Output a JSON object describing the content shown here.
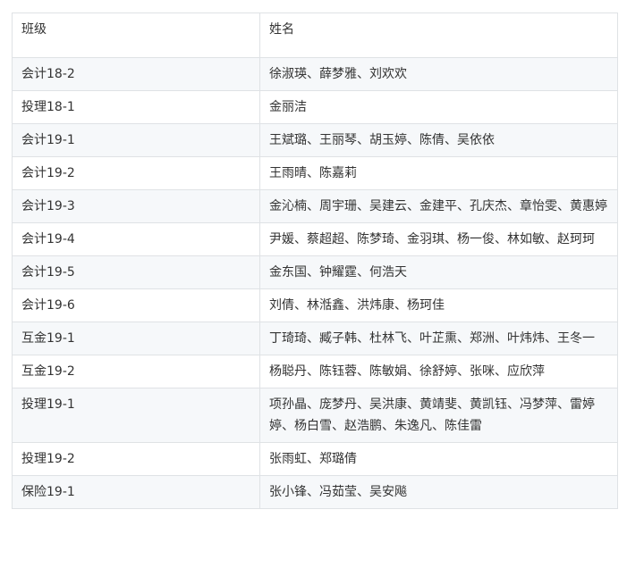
{
  "table": {
    "headers": [
      "班级",
      "姓名"
    ],
    "rows": [
      [
        "会计18-2",
        "徐淑瑛、薛梦雅、刘欢欢"
      ],
      [
        "投理18-1",
        "金丽洁"
      ],
      [
        "会计19-1",
        "王斌璐、王丽琴、胡玉婷、陈倩、吴依依"
      ],
      [
        "会计19-2",
        "王雨晴、陈嘉莉"
      ],
      [
        "会计19-3",
        "金沁楠、周宇珊、吴建云、金建平、孔庆杰、章怡雯、黄惠婷"
      ],
      [
        "会计19-4",
        "尹媛、蔡超超、陈梦琦、金羽琪、杨一俊、林如敏、赵珂珂"
      ],
      [
        "会计19-5",
        "金东国、钟耀霆、何浩天"
      ],
      [
        "会计19-6",
        "刘倩、林湉鑫、洪炜康、杨珂佳"
      ],
      [
        "互金19-1",
        "丁琦琦、臧子韩、杜林飞、叶芷熏、郑洲、叶炜炜、王冬一"
      ],
      [
        "互金19-2",
        "杨聪丹、陈钰蓉、陈敏娟、徐舒婷、张咪、应欣萍"
      ],
      [
        "投理19-1",
        "项孙晶、庞梦丹、吴洪康、黄靖斐、黄凯钰、冯梦萍、雷婷婷、杨白雪、赵浩鹏、朱逸凡、陈佳雷"
      ],
      [
        "投理19-2",
        "张雨虹、郑璐倩"
      ],
      [
        "保险19-1",
        "张小锋、冯茹莹、吴安飚"
      ]
    ]
  }
}
